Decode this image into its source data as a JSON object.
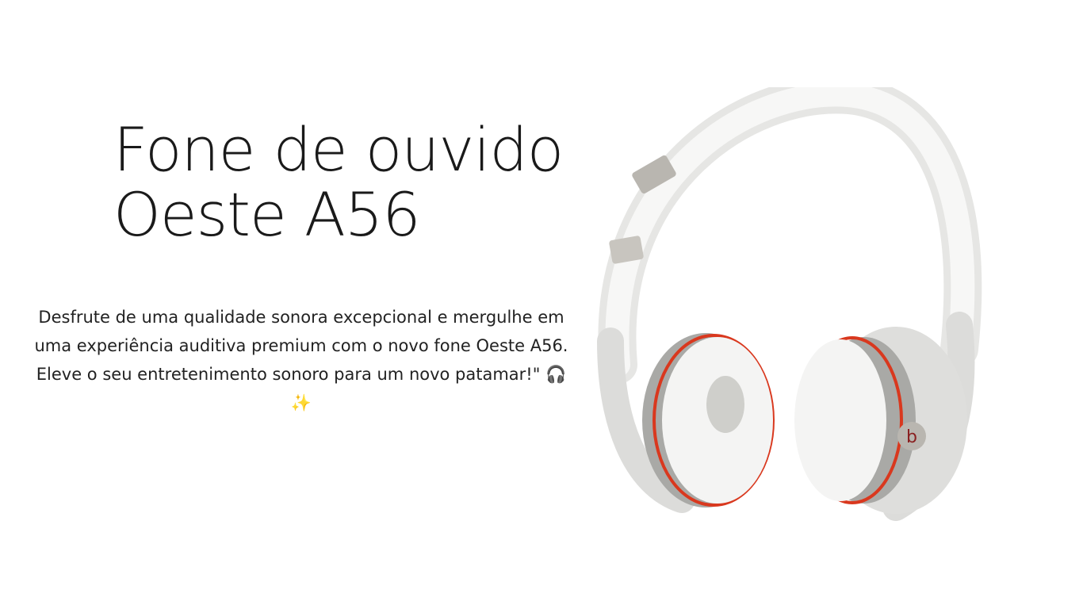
{
  "title": {
    "line1": "Fone de ouvido",
    "line2": "Oeste A56"
  },
  "description": "Desfrute de uma qualidade sonora excepcional e mergulhe em uma experiência auditiva premium com o novo fone Oeste A56. Eleve o seu entretenimento sonoro para um novo patamar!\" 🎧✨",
  "image": {
    "icon": "headphones-image",
    "accent_color": "#d9381e"
  }
}
